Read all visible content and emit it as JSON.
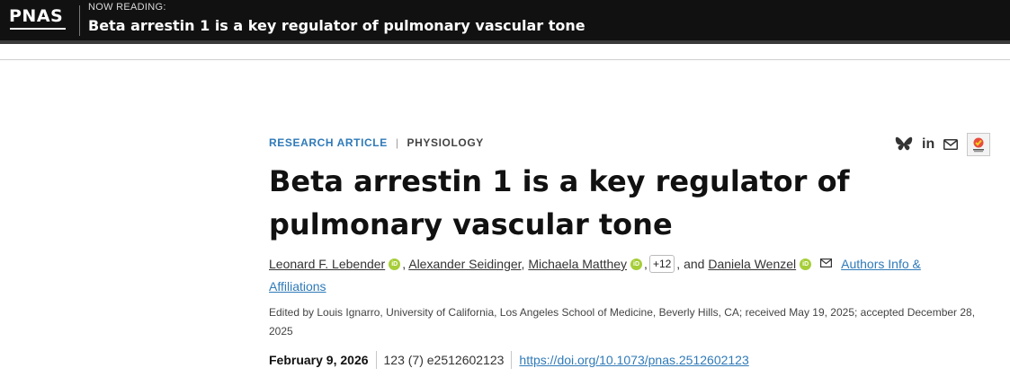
{
  "header": {
    "logo": "PNAS",
    "now_reading_label": "NOW READING:",
    "now_reading_title": "Beta arrestin 1 is a key regulator of pulmonary vascular tone"
  },
  "article": {
    "type": "RESEARCH ARTICLE",
    "separator": "|",
    "subject": "PHYSIOLOGY",
    "title": "Beta arrestin 1 is a key regulator of pulmonary vascular tone",
    "authors": [
      {
        "name": "Leonard F. Lebender",
        "orcid": true
      },
      {
        "name": "Alexander Seidinger",
        "orcid": false
      },
      {
        "name": "Michaela Matthey",
        "orcid": true
      },
      {
        "name": "Daniela Wenzel",
        "orcid": true
      }
    ],
    "orcid_text": "iD",
    "comma": ",",
    "more_authors": "+12",
    "and_text": ", and",
    "authors_info_link": "Authors Info & Affiliations",
    "edited_by": "Edited by Louis Ignarro, University of California, Los Angeles School of Medicine, Beverly Hills, CA; received May 19, 2025; accepted December 28, 2025",
    "pub_date": "February 9, 2026",
    "volume_issue": "123 (7) e2512602123",
    "doi": "https://doi.org/10.1073/pnas.2512602123"
  },
  "share": {
    "icons": [
      "bluesky-icon",
      "linkedin-icon",
      "email-icon",
      "check-for-updates-icon"
    ],
    "linkedin_text": "in"
  },
  "colors": {
    "accent": "#2f7ab8",
    "orcid": "#a6ce39",
    "topbar": "#111111"
  }
}
